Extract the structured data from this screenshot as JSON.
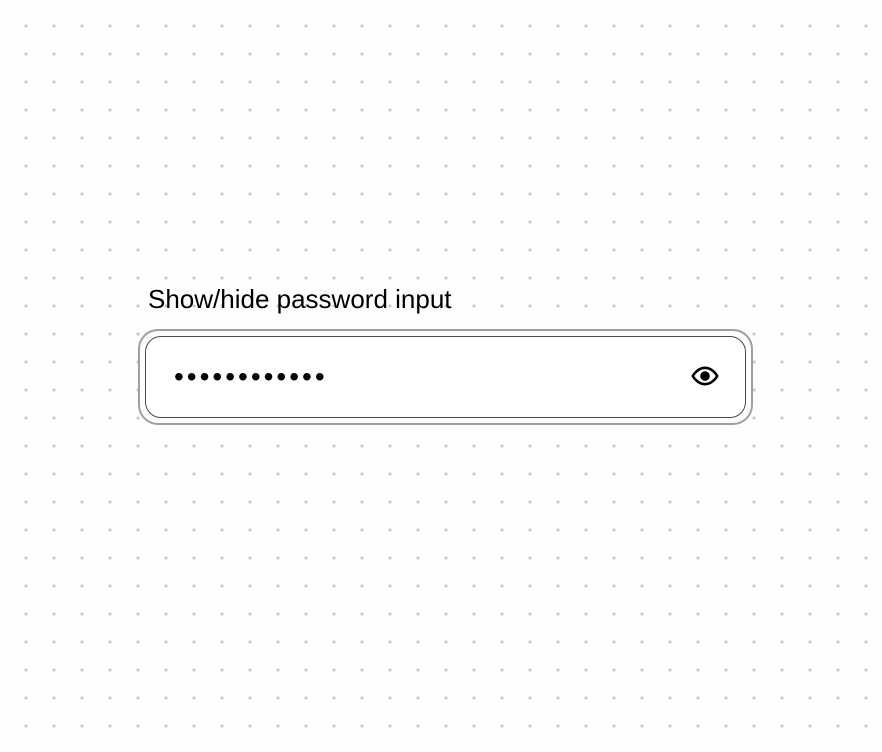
{
  "form": {
    "label": "Show/hide password input",
    "password_value": "••••••••••••",
    "password_placeholder": "",
    "toggle_aria": "Show password",
    "icon_name": "eye-icon"
  }
}
